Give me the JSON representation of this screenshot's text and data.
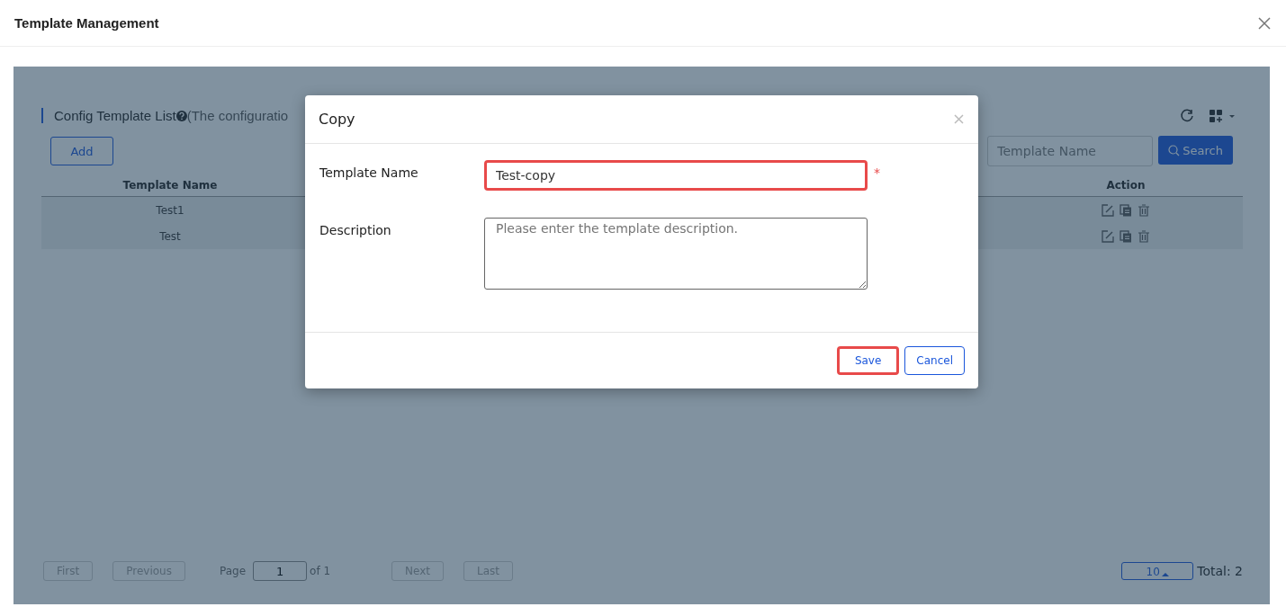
{
  "window": {
    "title": "Template Management"
  },
  "list": {
    "title": "Config Template List",
    "note": "(The configuratio",
    "add_button": "Add",
    "search": {
      "placeholder": "Template Name",
      "button": "Search"
    }
  },
  "table": {
    "columns": [
      {
        "label": "Template Name"
      },
      {
        "label": "Action"
      }
    ],
    "rows": [
      {
        "name": "Test1"
      },
      {
        "name": "Test"
      }
    ]
  },
  "pagination": {
    "first": "First",
    "previous": "Previous",
    "page_label": "Page",
    "page": "1",
    "of": "of 1",
    "next": "Next",
    "last": "Last",
    "page_size": "10",
    "total": "Total: 2"
  },
  "dialog": {
    "title": "Copy",
    "fields": [
      {
        "kind": "input",
        "label": "Template Name",
        "value": "Test-copy",
        "required_mark": "*",
        "highlighted": true
      },
      {
        "kind": "textarea",
        "label": "Description",
        "placeholder": "Please enter the template description.",
        "highlighted": false
      }
    ],
    "buttons": [
      {
        "label": "Save",
        "highlighted": true
      },
      {
        "label": "Cancel",
        "highlighted": false
      }
    ]
  }
}
